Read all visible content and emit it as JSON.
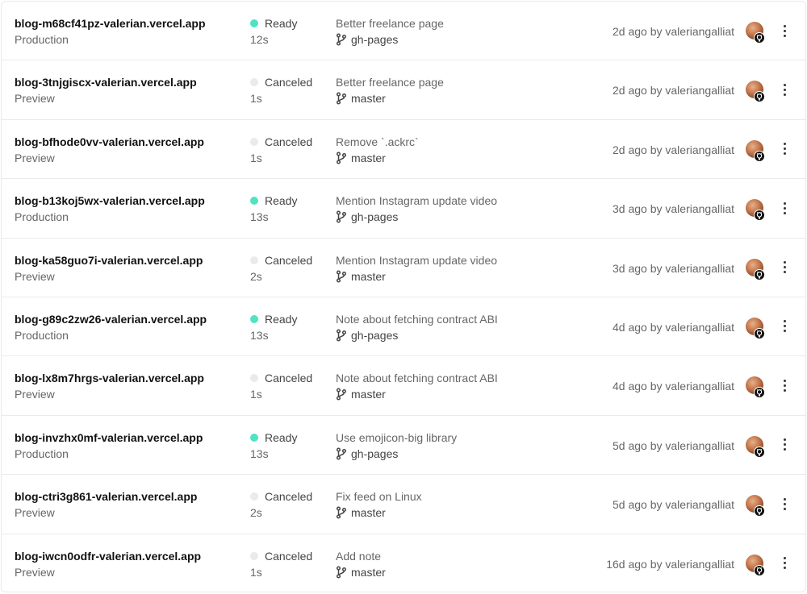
{
  "deployments": [
    {
      "url": "blog-m68cf41pz-valerian.vercel.app",
      "environment": "Production",
      "status": "Ready",
      "duration": "12s",
      "commit_message": "Better freelance page",
      "branch": "gh-pages",
      "age_author": "2d ago by valeriangalliat"
    },
    {
      "url": "blog-3tnjgiscx-valerian.vercel.app",
      "environment": "Preview",
      "status": "Canceled",
      "duration": "1s",
      "commit_message": "Better freelance page",
      "branch": "master",
      "age_author": "2d ago by valeriangalliat"
    },
    {
      "url": "blog-bfhode0vv-valerian.vercel.app",
      "environment": "Preview",
      "status": "Canceled",
      "duration": "1s",
      "commit_message": "Remove `.ackrc`",
      "branch": "master",
      "age_author": "2d ago by valeriangalliat"
    },
    {
      "url": "blog-b13koj5wx-valerian.vercel.app",
      "environment": "Production",
      "status": "Ready",
      "duration": "13s",
      "commit_message": "Mention Instagram update video",
      "branch": "gh-pages",
      "age_author": "3d ago by valeriangalliat"
    },
    {
      "url": "blog-ka58guo7i-valerian.vercel.app",
      "environment": "Preview",
      "status": "Canceled",
      "duration": "2s",
      "commit_message": "Mention Instagram update video",
      "branch": "master",
      "age_author": "3d ago by valeriangalliat"
    },
    {
      "url": "blog-g89c2zw26-valerian.vercel.app",
      "environment": "Production",
      "status": "Ready",
      "duration": "13s",
      "commit_message": "Note about fetching contract ABI",
      "branch": "gh-pages",
      "age_author": "4d ago by valeriangalliat"
    },
    {
      "url": "blog-lx8m7hrgs-valerian.vercel.app",
      "environment": "Preview",
      "status": "Canceled",
      "duration": "1s",
      "commit_message": "Note about fetching contract ABI",
      "branch": "master",
      "age_author": "4d ago by valeriangalliat"
    },
    {
      "url": "blog-invzhx0mf-valerian.vercel.app",
      "environment": "Production",
      "status": "Ready",
      "duration": "13s",
      "commit_message": "Use emojicon-big library",
      "branch": "gh-pages",
      "age_author": "5d ago by valeriangalliat"
    },
    {
      "url": "blog-ctri3g861-valerian.vercel.app",
      "environment": "Preview",
      "status": "Canceled",
      "duration": "2s",
      "commit_message": "Fix feed on Linux",
      "branch": "master",
      "age_author": "5d ago by valeriangalliat"
    },
    {
      "url": "blog-iwcn0odfr-valerian.vercel.app",
      "environment": "Preview",
      "status": "Canceled",
      "duration": "1s",
      "commit_message": "Add note",
      "branch": "master",
      "age_author": "16d ago by valeriangalliat"
    }
  ],
  "icons": {
    "status_dot": "status-dot-icon",
    "branch": "git-branch-icon",
    "avatar_badge": "github-icon",
    "menu": "more-vertical-icon"
  },
  "colors": {
    "ready": "#50e3c2",
    "canceled": "#eaeaea",
    "border": "#eaeaea",
    "muted_text": "#666666"
  }
}
